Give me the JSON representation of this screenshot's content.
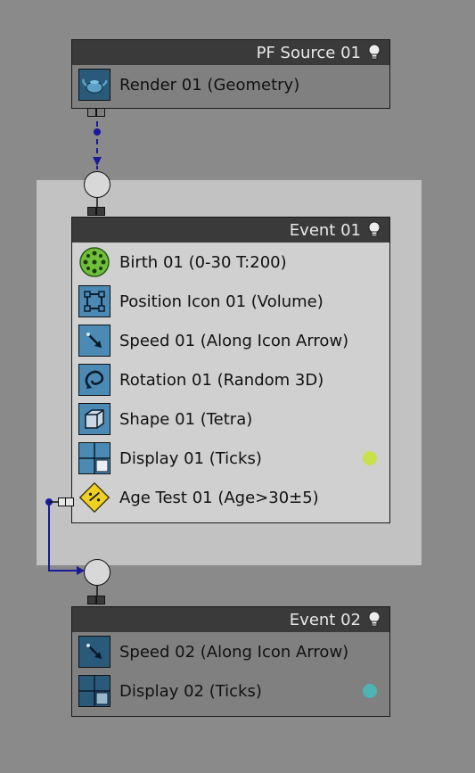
{
  "nodes": {
    "pf_source": {
      "title": "PF Source 01",
      "operators": [
        {
          "label": "Render 01 (Geometry)",
          "icon": "teapot-icon"
        }
      ]
    },
    "event01": {
      "title": "Event 01",
      "operators": [
        {
          "label": "Birth 01 (0-30 T:200)",
          "icon": "birth-icon"
        },
        {
          "label": "Position Icon 01 (Volume)",
          "icon": "position-icon"
        },
        {
          "label": "Speed 01 (Along Icon Arrow)",
          "icon": "speed-icon"
        },
        {
          "label": "Rotation 01 (Random 3D)",
          "icon": "rotation-icon"
        },
        {
          "label": "Shape 01 (Tetra)",
          "icon": "shape-icon"
        },
        {
          "label": "Display 01 (Ticks)",
          "icon": "display-icon",
          "status_color": "#c8e04a"
        },
        {
          "label": "Age Test 01 (Age>30±5)",
          "icon": "age-test-icon"
        }
      ]
    },
    "event02": {
      "title": "Event 02",
      "operators": [
        {
          "label": "Speed 02 (Along Icon Arrow)",
          "icon": "speed-icon"
        },
        {
          "label": "Display 02 (Ticks)",
          "icon": "display-icon",
          "status_color": "#4db3b3"
        }
      ]
    }
  },
  "colors": {
    "wire": "#1a1a9a",
    "selection": "#c2c2c2",
    "canvas": "#8a8a8a",
    "header": "#3a3a3a"
  }
}
